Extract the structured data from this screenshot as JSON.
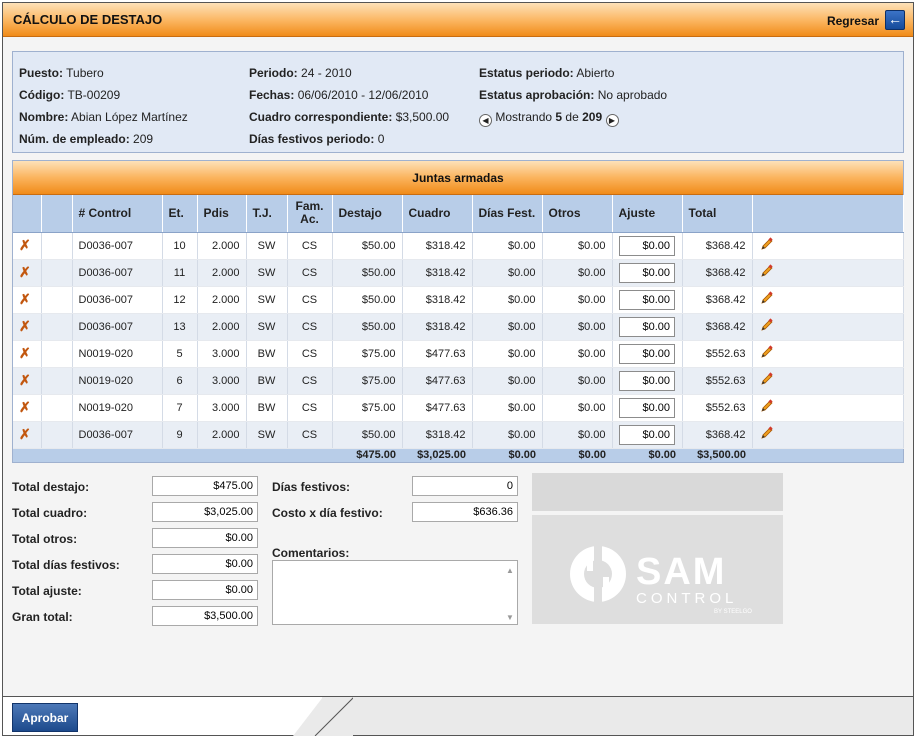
{
  "header": {
    "title": "CÁLCULO DE DESTAJO",
    "back_label": "Regresar"
  },
  "info": {
    "col1": [
      {
        "label": "Puesto:",
        "value": "Tubero"
      },
      {
        "label": "Código:",
        "value": "TB-00209"
      },
      {
        "label": "Nombre:",
        "value": "Abian López Martínez"
      },
      {
        "label": "Núm. de empleado:",
        "value": "209"
      }
    ],
    "col2": [
      {
        "label": "Periodo:",
        "value": "24 - 2010"
      },
      {
        "label": "Fechas:",
        "value": "06/06/2010 - 12/06/2010"
      },
      {
        "label": "Cuadro correspondiente:",
        "value": "$3,500.00"
      },
      {
        "label": "Días festivos periodo:",
        "value": "0"
      }
    ],
    "col3": [
      {
        "label": "Estatus periodo:",
        "value": "Abierto"
      },
      {
        "label": "Estatus aprobación:",
        "value": "No aprobado"
      }
    ],
    "showing": {
      "prefix": "Mostrando",
      "current": "5",
      "of": "de",
      "total": "209"
    }
  },
  "grid": {
    "title": "Juntas armadas",
    "headers": [
      "",
      "",
      "# Control",
      "Et.",
      "Pdis",
      "T.J.",
      "Fam. Ac.",
      "Destajo",
      "Cuadro",
      "Días Fest.",
      "Otros",
      "Ajuste",
      "Total",
      ""
    ],
    "rows": [
      {
        "control": "D0036-007",
        "et": "10",
        "pdis": "2.000",
        "tj": "SW",
        "fam": "CS",
        "destajo": "$50.00",
        "cuadro": "$318.42",
        "dias": "$0.00",
        "otros": "$0.00",
        "ajuste": "$0.00",
        "total": "$368.42"
      },
      {
        "control": "D0036-007",
        "et": "11",
        "pdis": "2.000",
        "tj": "SW",
        "fam": "CS",
        "destajo": "$50.00",
        "cuadro": "$318.42",
        "dias": "$0.00",
        "otros": "$0.00",
        "ajuste": "$0.00",
        "total": "$368.42"
      },
      {
        "control": "D0036-007",
        "et": "12",
        "pdis": "2.000",
        "tj": "SW",
        "fam": "CS",
        "destajo": "$50.00",
        "cuadro": "$318.42",
        "dias": "$0.00",
        "otros": "$0.00",
        "ajuste": "$0.00",
        "total": "$368.42"
      },
      {
        "control": "D0036-007",
        "et": "13",
        "pdis": "2.000",
        "tj": "SW",
        "fam": "CS",
        "destajo": "$50.00",
        "cuadro": "$318.42",
        "dias": "$0.00",
        "otros": "$0.00",
        "ajuste": "$0.00",
        "total": "$368.42"
      },
      {
        "control": "N0019-020",
        "et": "5",
        "pdis": "3.000",
        "tj": "BW",
        "fam": "CS",
        "destajo": "$75.00",
        "cuadro": "$477.63",
        "dias": "$0.00",
        "otros": "$0.00",
        "ajuste": "$0.00",
        "total": "$552.63"
      },
      {
        "control": "N0019-020",
        "et": "6",
        "pdis": "3.000",
        "tj": "BW",
        "fam": "CS",
        "destajo": "$75.00",
        "cuadro": "$477.63",
        "dias": "$0.00",
        "otros": "$0.00",
        "ajuste": "$0.00",
        "total": "$552.63"
      },
      {
        "control": "N0019-020",
        "et": "7",
        "pdis": "3.000",
        "tj": "BW",
        "fam": "CS",
        "destajo": "$75.00",
        "cuadro": "$477.63",
        "dias": "$0.00",
        "otros": "$0.00",
        "ajuste": "$0.00",
        "total": "$552.63"
      },
      {
        "control": "D0036-007",
        "et": "9",
        "pdis": "2.000",
        "tj": "SW",
        "fam": "CS",
        "destajo": "$50.00",
        "cuadro": "$318.42",
        "dias": "$0.00",
        "otros": "$0.00",
        "ajuste": "$0.00",
        "total": "$368.42"
      }
    ],
    "totals": {
      "destajo": "$475.00",
      "cuadro": "$3,025.00",
      "dias": "$0.00",
      "otros": "$0.00",
      "ajuste": "$0.00",
      "total": "$3,500.00"
    },
    "row_icons": {
      "delete": "x-remove-icon",
      "edit": "pencil-icon"
    }
  },
  "summary": {
    "left": [
      {
        "label": "Total destajo:",
        "value": "$475.00"
      },
      {
        "label": "Total cuadro:",
        "value": "$3,025.00"
      },
      {
        "label": "Total otros:",
        "value": "$0.00"
      },
      {
        "label": "Total días festivos:",
        "value": "$0.00"
      },
      {
        "label": "Total ajuste:",
        "value": "$0.00"
      },
      {
        "label": "Gran total:",
        "value": "$3,500.00"
      }
    ],
    "dias_festivos": {
      "label": "Días festivos:",
      "value": "0"
    },
    "costo_dia": {
      "label": "Costo x día festivo:",
      "value": "$636.36"
    },
    "comentarios": {
      "label": "Comentarios:",
      "value": ""
    }
  },
  "logo": {
    "brand": "SAM",
    "sub": "CONTROL",
    "by": "BY STEELGO"
  },
  "footer": {
    "approve_label": "Aprobar"
  },
  "colors": {
    "accent_orange": "#f08b19",
    "header_blue": "#b8cde8",
    "panel_blue": "#e1e9f5",
    "button_blue": "#1d4a8c"
  }
}
